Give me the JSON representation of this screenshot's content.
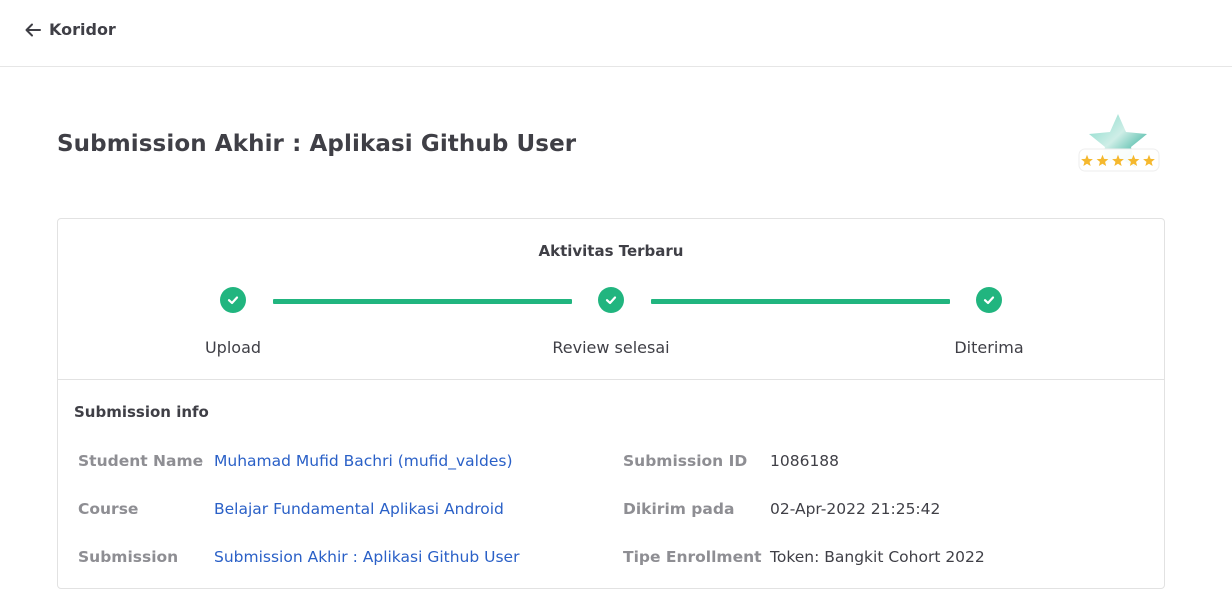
{
  "header": {
    "back_label": "Koridor"
  },
  "page": {
    "title": "Submission Akhir : Aplikasi Github User"
  },
  "colors": {
    "accent": "#21b57f",
    "link": "#2a60c7",
    "star": "#f5b82e"
  },
  "activity": {
    "title": "Aktivitas Terbaru",
    "steps": [
      {
        "label": "Upload",
        "status": "done"
      },
      {
        "label": "Review selesai",
        "status": "done"
      },
      {
        "label": "Diterima",
        "status": "done"
      }
    ]
  },
  "rating": {
    "stars": 5,
    "max": 5
  },
  "info": {
    "title": "Submission info",
    "student_name_label": "Student Name",
    "student_name_value": "Muhamad Mufid Bachri (mufid_valdes)",
    "course_label": "Course",
    "course_value": "Belajar Fundamental Aplikasi Android",
    "submission_label": "Submission",
    "submission_value": "Submission Akhir : Aplikasi Github User",
    "submission_id_label": "Submission ID",
    "submission_id_value": "1086188",
    "sent_label": "Dikirim pada",
    "sent_value": "02-Apr-2022 21:25:42",
    "enrollment_label": "Tipe Enrollment",
    "enrollment_value": "Token: Bangkit Cohort 2022"
  }
}
